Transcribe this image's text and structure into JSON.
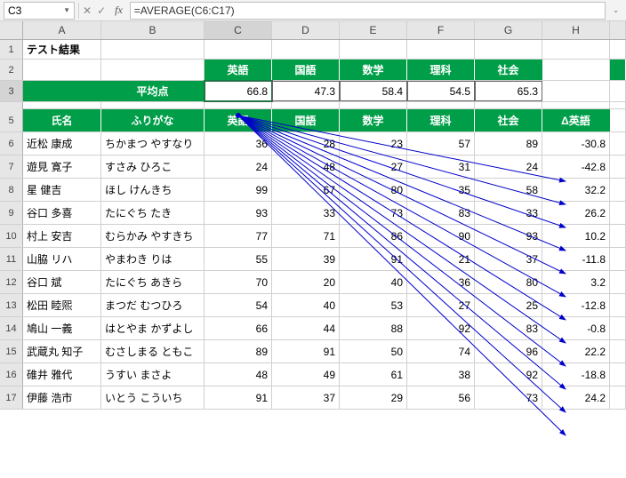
{
  "namebox": "C3",
  "formula": "=AVERAGE(C6:C17)",
  "title_cell": "テスト結果",
  "avg_label": "平均点",
  "subject_headers": [
    "英語",
    "国語",
    "数学",
    "理科",
    "社会"
  ],
  "averages": [
    "66.8",
    "47.3",
    "58.4",
    "54.5",
    "65.3"
  ],
  "table_headers": [
    "氏名",
    "ふりがな",
    "英語",
    "国語",
    "数学",
    "理科",
    "社会",
    "Δ英語"
  ],
  "col_letters": [
    "A",
    "B",
    "C",
    "D",
    "E",
    "F",
    "G",
    "H"
  ],
  "rows": [
    {
      "n": "6",
      "name": "近松 康成",
      "kana": "ちかまつ やすなり",
      "s": [
        36,
        28,
        23,
        57,
        89
      ],
      "d": "-30.8"
    },
    {
      "n": "7",
      "name": "遊見 寛子",
      "kana": "すさみ ひろこ",
      "s": [
        24,
        48,
        27,
        31,
        24
      ],
      "d": "-42.8"
    },
    {
      "n": "8",
      "name": "星 健吉",
      "kana": "ほし けんきち",
      "s": [
        99,
        67,
        80,
        35,
        58
      ],
      "d": "32.2"
    },
    {
      "n": "9",
      "name": "谷口 多喜",
      "kana": "たにぐち たき",
      "s": [
        93,
        33,
        73,
        83,
        33
      ],
      "d": "26.2"
    },
    {
      "n": "10",
      "name": "村上 安吉",
      "kana": "むらかみ やすきち",
      "s": [
        77,
        71,
        86,
        90,
        93
      ],
      "d": "10.2"
    },
    {
      "n": "11",
      "name": "山脇 リハ",
      "kana": "やまわき りは",
      "s": [
        55,
        39,
        91,
        21,
        37
      ],
      "d": "-11.8"
    },
    {
      "n": "12",
      "name": "谷口 斌",
      "kana": "たにぐち あきら",
      "s": [
        70,
        20,
        40,
        36,
        80
      ],
      "d": "3.2"
    },
    {
      "n": "13",
      "name": "松田 睦煕",
      "kana": "まつだ むつひろ",
      "s": [
        54,
        40,
        53,
        27,
        25
      ],
      "d": "-12.8"
    },
    {
      "n": "14",
      "name": "鳩山 一義",
      "kana": "はとやま かずよし",
      "s": [
        66,
        44,
        88,
        92,
        83
      ],
      "d": "-0.8"
    },
    {
      "n": "15",
      "name": "武蔵丸 知子",
      "kana": "むさしまる ともこ",
      "s": [
        89,
        91,
        50,
        74,
        96
      ],
      "d": "22.2"
    },
    {
      "n": "16",
      "name": "碓井 雅代",
      "kana": "うすい まさよ",
      "s": [
        48,
        49,
        61,
        38,
        92
      ],
      "d": "-18.8"
    },
    {
      "n": "17",
      "name": "伊藤 浩市",
      "kana": "いとう こういち",
      "s": [
        91,
        37,
        29,
        56,
        73
      ],
      "d": "24.2"
    }
  ],
  "chart_data": {
    "type": "table",
    "title": "テスト結果",
    "columns": [
      "氏名",
      "ふりがな",
      "英語",
      "国語",
      "数学",
      "理科",
      "社会",
      "Δ英語"
    ],
    "averages": {
      "英語": 66.8,
      "国語": 47.3,
      "数学": 58.4,
      "理科": 54.5,
      "社会": 65.3
    }
  }
}
